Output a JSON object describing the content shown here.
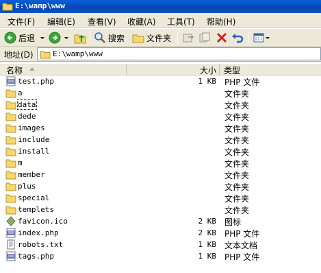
{
  "window": {
    "title": "E:\\wamp\\www"
  },
  "menu": [
    {
      "label": "文件(F)"
    },
    {
      "label": "编辑(E)"
    },
    {
      "label": "查看(V)"
    },
    {
      "label": "收藏(A)"
    },
    {
      "label": "工具(T)"
    },
    {
      "label": "帮助(H)"
    }
  ],
  "toolbar": {
    "back_label": "后退",
    "search_label": "搜索",
    "folders_label": "文件夹"
  },
  "address": {
    "label": "地址(D)",
    "value": "E:\\wamp\\www"
  },
  "columns": {
    "name": "名称",
    "size": "大小",
    "type": "类型"
  },
  "files": [
    {
      "name": "test.php",
      "size": "1 KB",
      "type": "PHP 文件",
      "icon": "php-file-icon"
    },
    {
      "name": "a",
      "size": "",
      "type": "文件夹",
      "icon": "folder-icon"
    },
    {
      "name": "data",
      "size": "",
      "type": "文件夹",
      "icon": "folder-icon"
    },
    {
      "name": "dede",
      "size": "",
      "type": "文件夹",
      "icon": "folder-icon"
    },
    {
      "name": "images",
      "size": "",
      "type": "文件夹",
      "icon": "folder-icon"
    },
    {
      "name": "include",
      "size": "",
      "type": "文件夹",
      "icon": "folder-icon"
    },
    {
      "name": "install",
      "size": "",
      "type": "文件夹",
      "icon": "folder-icon"
    },
    {
      "name": "m",
      "size": "",
      "type": "文件夹",
      "icon": "folder-icon"
    },
    {
      "name": "member",
      "size": "",
      "type": "文件夹",
      "icon": "folder-icon"
    },
    {
      "name": "plus",
      "size": "",
      "type": "文件夹",
      "icon": "folder-icon"
    },
    {
      "name": "special",
      "size": "",
      "type": "文件夹",
      "icon": "folder-icon"
    },
    {
      "name": "templets",
      "size": "",
      "type": "文件夹",
      "icon": "folder-icon"
    },
    {
      "name": "favicon.ico",
      "size": "2 KB",
      "type": "图标",
      "icon": "favicon-file-icon"
    },
    {
      "name": "index.php",
      "size": "2 KB",
      "type": "PHP 文件",
      "icon": "php-file-icon"
    },
    {
      "name": "robots.txt",
      "size": "1 KB",
      "type": "文本文档",
      "icon": "text-file-icon"
    },
    {
      "name": "tags.php",
      "size": "1 KB",
      "type": "PHP 文件",
      "icon": "php-file-icon"
    }
  ]
}
